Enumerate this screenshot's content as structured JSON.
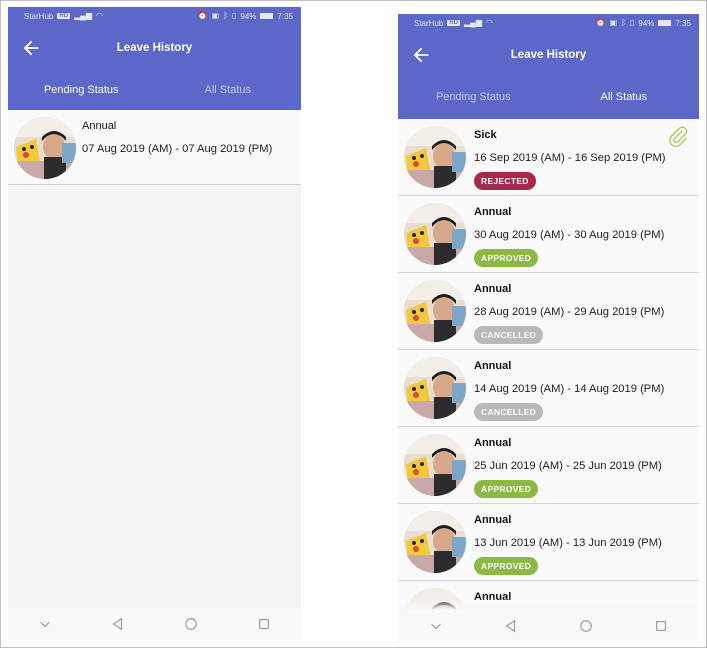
{
  "left_screen": {
    "status_bar": {
      "carrier": "StarHub",
      "carrier_badge": "HD",
      "battery": "94%",
      "battery_level": 0.94,
      "time": "7:35"
    },
    "title": "Leave History",
    "tabs": [
      {
        "label": "Pending Status",
        "active": true
      },
      {
        "label": "All Status",
        "active": false
      }
    ],
    "items": [
      {
        "type": "Annual",
        "dates": "07 Aug 2019 (AM) - 07 Aug 2019 (PM)"
      }
    ]
  },
  "right_screen": {
    "status_bar": {
      "carrier": "StarHub",
      "carrier_badge": "HD",
      "battery": "94%",
      "battery_level": 0.94,
      "time": "7:35"
    },
    "title": "Leave History",
    "tabs": [
      {
        "label": "Pending Status",
        "active": false
      },
      {
        "label": "All Status",
        "active": true
      }
    ],
    "items": [
      {
        "type": "Sick",
        "dates": "16 Sep 2019 (AM) - 16 Sep 2019 (PM)",
        "status": "REJECTED",
        "has_attachment": true
      },
      {
        "type": "Annual",
        "dates": "30 Aug 2019 (AM) - 30 Aug 2019 (PM)",
        "status": "APPROVED"
      },
      {
        "type": "Annual",
        "dates": "28 Aug 2019 (AM) - 29 Aug 2019 (PM)",
        "status": "CANCELLED"
      },
      {
        "type": "Annual",
        "dates": "14 Aug 2019 (AM) - 14 Aug 2019 (PM)",
        "status": "CANCELLED"
      },
      {
        "type": "Annual",
        "dates": "25 Jun 2019 (AM) - 25 Jun 2019 (PM)",
        "status": "APPROVED"
      },
      {
        "type": "Annual",
        "dates": "13 Jun 2019 (AM) - 13 Jun 2019 (PM)",
        "status": "APPROVED"
      },
      {
        "type": "Annual"
      }
    ]
  },
  "colors": {
    "app_bar": "#5b67c9",
    "rejected": "#a8294a",
    "approved": "#8bba44",
    "cancelled": "#b9b9b9",
    "attachment": "#a9cf6a"
  },
  "icons": {
    "back": "arrow-left-icon",
    "attachment": "paperclip-icon",
    "nav": [
      "chevron-down-icon",
      "back-triangle-icon",
      "home-circle-icon",
      "recents-square-icon"
    ]
  }
}
